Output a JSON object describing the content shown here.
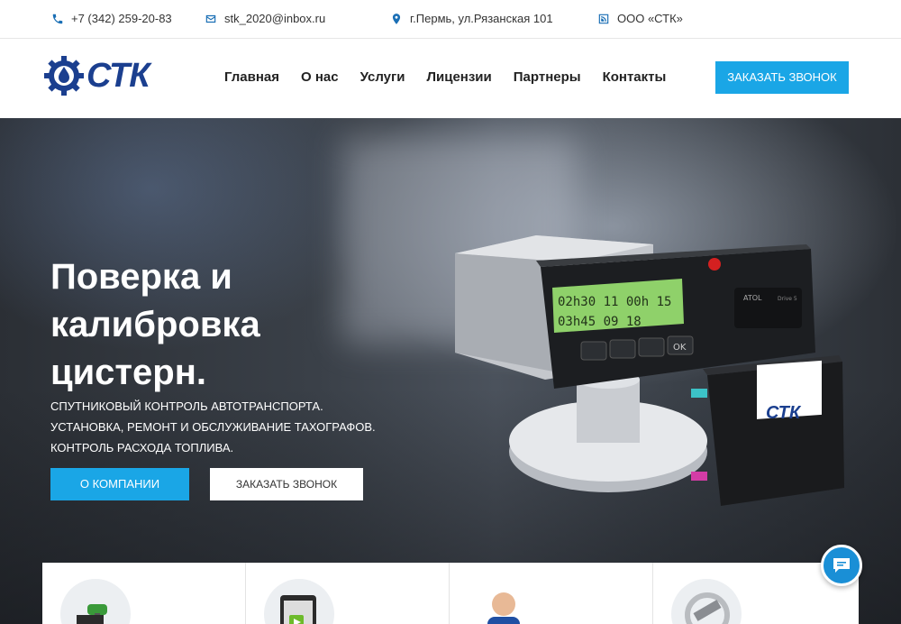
{
  "topbar": {
    "phone": "+7 (342) 259-20-83",
    "email": "stk_2020@inbox.ru",
    "address": "г.Пермь, ул.Рязанская 101",
    "company": "ООО «СТК»",
    "icons": [
      "phone-icon",
      "mail-icon",
      "location-pin-icon",
      "feed-icon"
    ]
  },
  "header": {
    "logo_text": "СТК",
    "nav": [
      "Главная",
      "О нас",
      "Услуги",
      "Лицензии",
      "Партнеры",
      "Контакты"
    ],
    "cta_label": "Заказать звонок"
  },
  "hero": {
    "title_lines": [
      "Поверка и",
      "калибровка",
      "цистерн."
    ],
    "subtitle_lines": [
      "СПУТНИКОВЫЙ КОНТРОЛЬ АВТОТРАНСПОРТА.",
      "УСТАНОВКА, РЕМОНТ И ОБСЛУЖИВАНИЕ ТАХОГРАФОВ.",
      "КОНТРОЛЬ РАСХОДА ТОПЛИВА."
    ],
    "primary_button": "О КОМПАНИИ",
    "secondary_button": "ЗАКАЗАТЬ ЗВОНОК"
  },
  "device": {
    "display_line1": "02h30 11 00h 15",
    "display_line2": "03h45  09 18",
    "brand": "ATOL",
    "model": "Drive 5",
    "box_logo": "СТК"
  },
  "colors": {
    "accent": "#1aa6e6",
    "brand": "#1b3f8f",
    "chat": "#1a8fd6"
  }
}
